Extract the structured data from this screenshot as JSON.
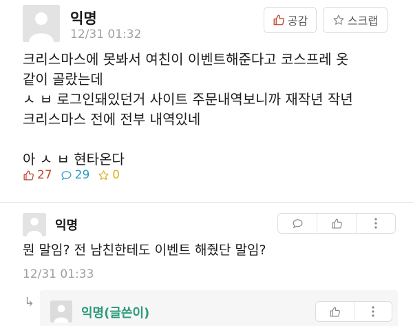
{
  "post": {
    "author": "익명",
    "time": "12/31 01:32",
    "buttons": {
      "like_label": "공감",
      "scrap_label": "스크랩"
    },
    "body_lines": [
      "크리스마스에 못봐서 여친이 이벤트해준다고 코스프레 옷",
      "같이 골랐는데",
      "ㅅ ㅂ 로그인돼있던거 사이트 주문내역보니까 재작년 작년",
      "크리스마스 전에 전부 내역있네",
      "",
      "아 ㅅ ㅂ 현타온다"
    ],
    "stats": {
      "likes": "27",
      "comments": "29",
      "scraps": "0"
    },
    "colors": {
      "likes": "#c0462a",
      "comments": "#2a9cc4",
      "scraps": "#d9b21f"
    }
  },
  "comment": {
    "author": "익명",
    "time": "12/31 01:33",
    "body": "뭔 말임? 전 남친한테도 이벤트 해줬단 말임?"
  },
  "reply": {
    "author": "익명(글쓴이)",
    "author_color": "#2b9a7a"
  }
}
